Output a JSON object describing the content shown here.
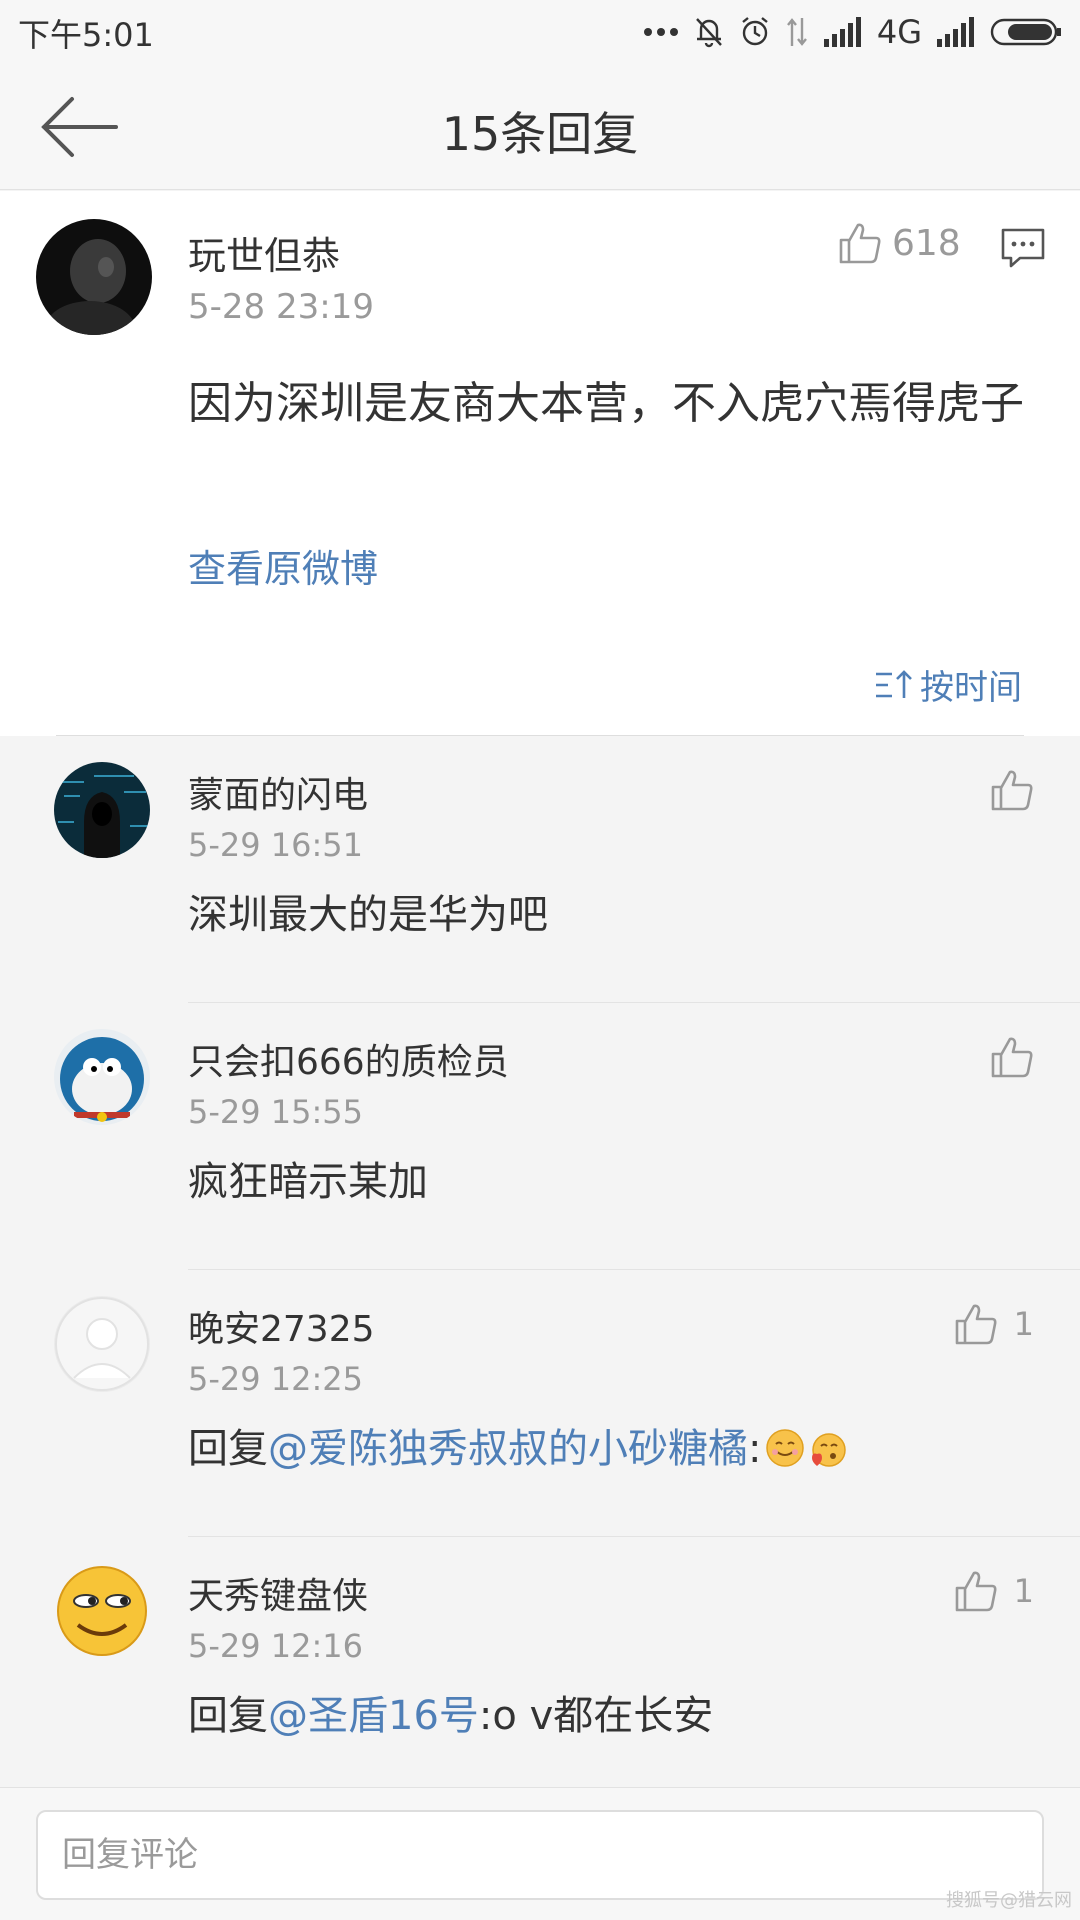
{
  "status_bar": {
    "time": "下午5:01",
    "network": "4G",
    "icons": [
      "more-dots-icon",
      "bell-muted-icon",
      "alarm-icon",
      "data-arrows-icon",
      "signal-icon",
      "signal-icon-2",
      "battery-icon"
    ]
  },
  "nav": {
    "title": "15条回复",
    "back_icon": "back-arrow-icon"
  },
  "main_comment": {
    "author": "玩世但恭",
    "time": "5-28 23:19",
    "likes": "618",
    "text": "因为深圳是友商大本营，不入虎穴焉得虎子",
    "view_original": "查看原微博",
    "sort_label": "按时间"
  },
  "replies": [
    {
      "author": "蒙面的闪电",
      "time": "5-29 16:51",
      "text": "深圳最大的是华为吧",
      "likes": ""
    },
    {
      "author": "只会扣666的质检员",
      "time": "5-29 15:55",
      "text": "疯狂暗示某加",
      "likes": ""
    },
    {
      "author": "晚安27325",
      "time": "5-29 12:25",
      "prefix": "回复",
      "mention": "@爱陈独秀叔叔的小砂糖橘",
      "text": ":",
      "likes": "1"
    },
    {
      "author": "天秀键盘侠",
      "time": "5-29 12:16",
      "prefix": "回复",
      "mention": "@圣盾16号",
      "text": ":o v都在长安",
      "likes": "1"
    }
  ],
  "bottom": {
    "placeholder": "回复评论"
  },
  "watermark": "搜狐号@猎云网",
  "colors": {
    "link": "#4f7fb7",
    "text": "#333333",
    "muted": "#9a9a9a",
    "background": "#f4f4f4"
  }
}
